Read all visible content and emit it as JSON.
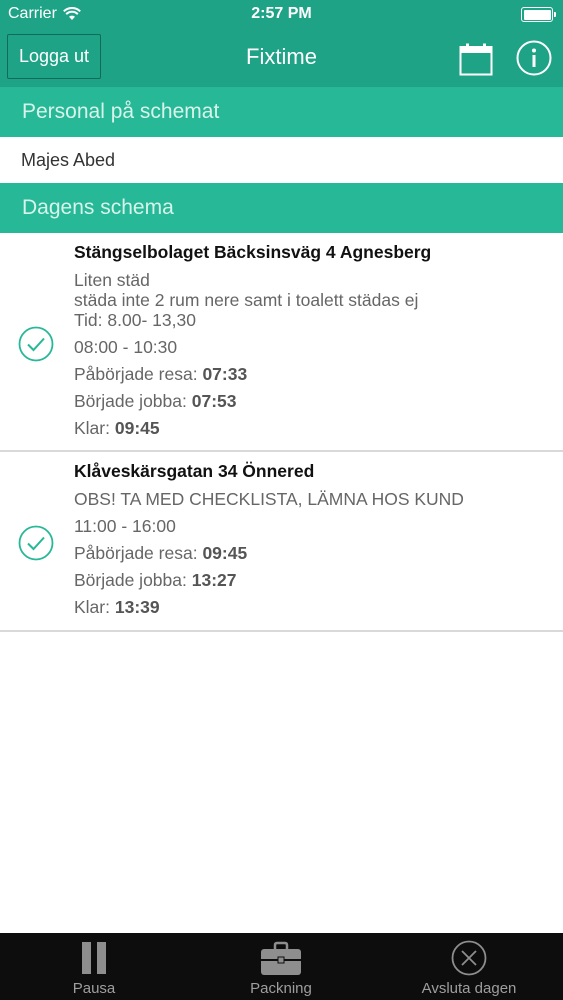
{
  "status_bar": {
    "carrier": "Carrier",
    "time": "2:57 PM"
  },
  "nav": {
    "logout_label": "Logga ut",
    "title": "Fixtime",
    "icons": [
      "calendar-icon",
      "info-icon"
    ]
  },
  "sections": {
    "staff_header": "Personal på schemat",
    "schedule_header": "Dagens schema"
  },
  "staff": [
    {
      "name": "Majes Abed"
    }
  ],
  "jobs": [
    {
      "title": "Stängselbolaget Bäcksinsväg 4 Agnesberg",
      "notes": [
        "Liten städ",
        "städa inte 2 rum nere samt i toalett städas ej",
        "Tid: 8.00- 13,30"
      ],
      "time_range": "08:00 - 10:30",
      "travel_label": "Påbörjade resa:",
      "travel_time": "07:33",
      "work_label": "Började jobba:",
      "work_time": "07:53",
      "done_label": "Klar:",
      "done_time": "09:45",
      "status_icon": "check-circle-icon"
    },
    {
      "title": "Klåveskärsgatan 34 Önnered",
      "notes": [
        "OBS! TA MED CHECKLISTA, LÄMNA HOS KUND"
      ],
      "time_range": "11:00 - 16:00",
      "travel_label": "Påbörjade resa:",
      "travel_time": "09:45",
      "work_label": "Började jobba:",
      "work_time": "13:27",
      "done_label": "Klar:",
      "done_time": "13:39",
      "status_icon": "check-circle-icon"
    }
  ],
  "tabs": [
    {
      "label": "Pausa",
      "icon": "pause-icon"
    },
    {
      "label": "Packning",
      "icon": "briefcase-icon"
    },
    {
      "label": "Avsluta dagen",
      "icon": "close-circle-icon"
    }
  ],
  "colors": {
    "nav_bar": "#1fa387",
    "section_header": "#27b898",
    "check": "#27b898",
    "tab_bar": "#0d0d0d"
  }
}
